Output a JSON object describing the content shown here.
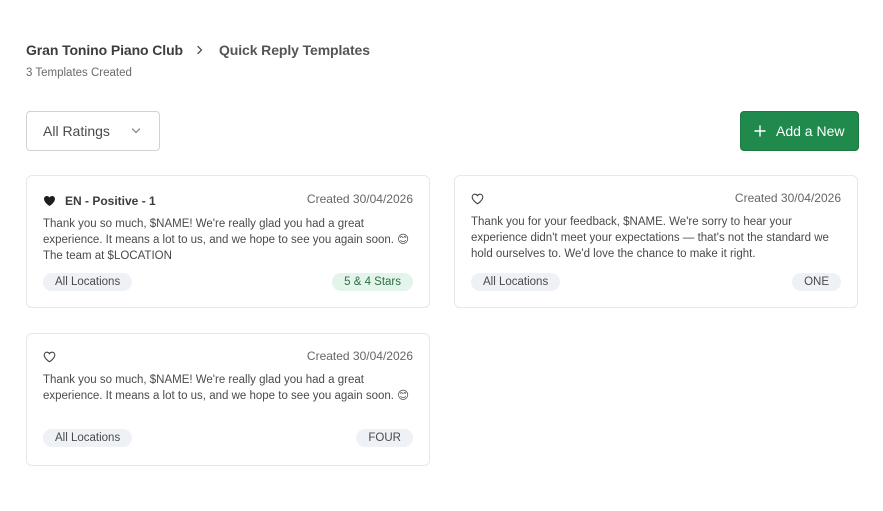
{
  "breadcrumb": {
    "club": "Gran Tonino Piano Club",
    "page": "Quick Reply Templates"
  },
  "subtitle": "3 Templates Created",
  "filter": {
    "selected": "All Ratings"
  },
  "add_button": {
    "label": "Add a New"
  },
  "colors": {
    "accent": "#1f8a4c",
    "pill_bg": "#eef1f5",
    "rating_green_bg": "#e3f4ea"
  },
  "cards": [
    {
      "name": "EN - Positive - 1",
      "favorite": true,
      "date": "Created 30/04/2026",
      "body": "Thank you so much, $NAME! We're really glad you had a great experience. It means a lot to us, and we hope to see you again soon. 😊 The team at $LOCATION",
      "location": "All Locations",
      "rating": "5 & 4 Stars"
    },
    {
      "name": "",
      "favorite": false,
      "date": "Created 30/04/2026",
      "body": "Thank you for your feedback, $NAME. We're sorry to hear your experience didn't meet your expectations — that's not the standard we hold ourselves to. We'd love the chance to make it right.",
      "location": "All Locations",
      "rating": "ONE"
    },
    {
      "name": "",
      "favorite": false,
      "date": "Created 30/04/2026",
      "body": "Thank you so much, $NAME! We're really glad you had a great experience. It means a lot to us, and we hope to see you again soon. 😊",
      "location": "All Locations",
      "rating": "FOUR"
    }
  ]
}
